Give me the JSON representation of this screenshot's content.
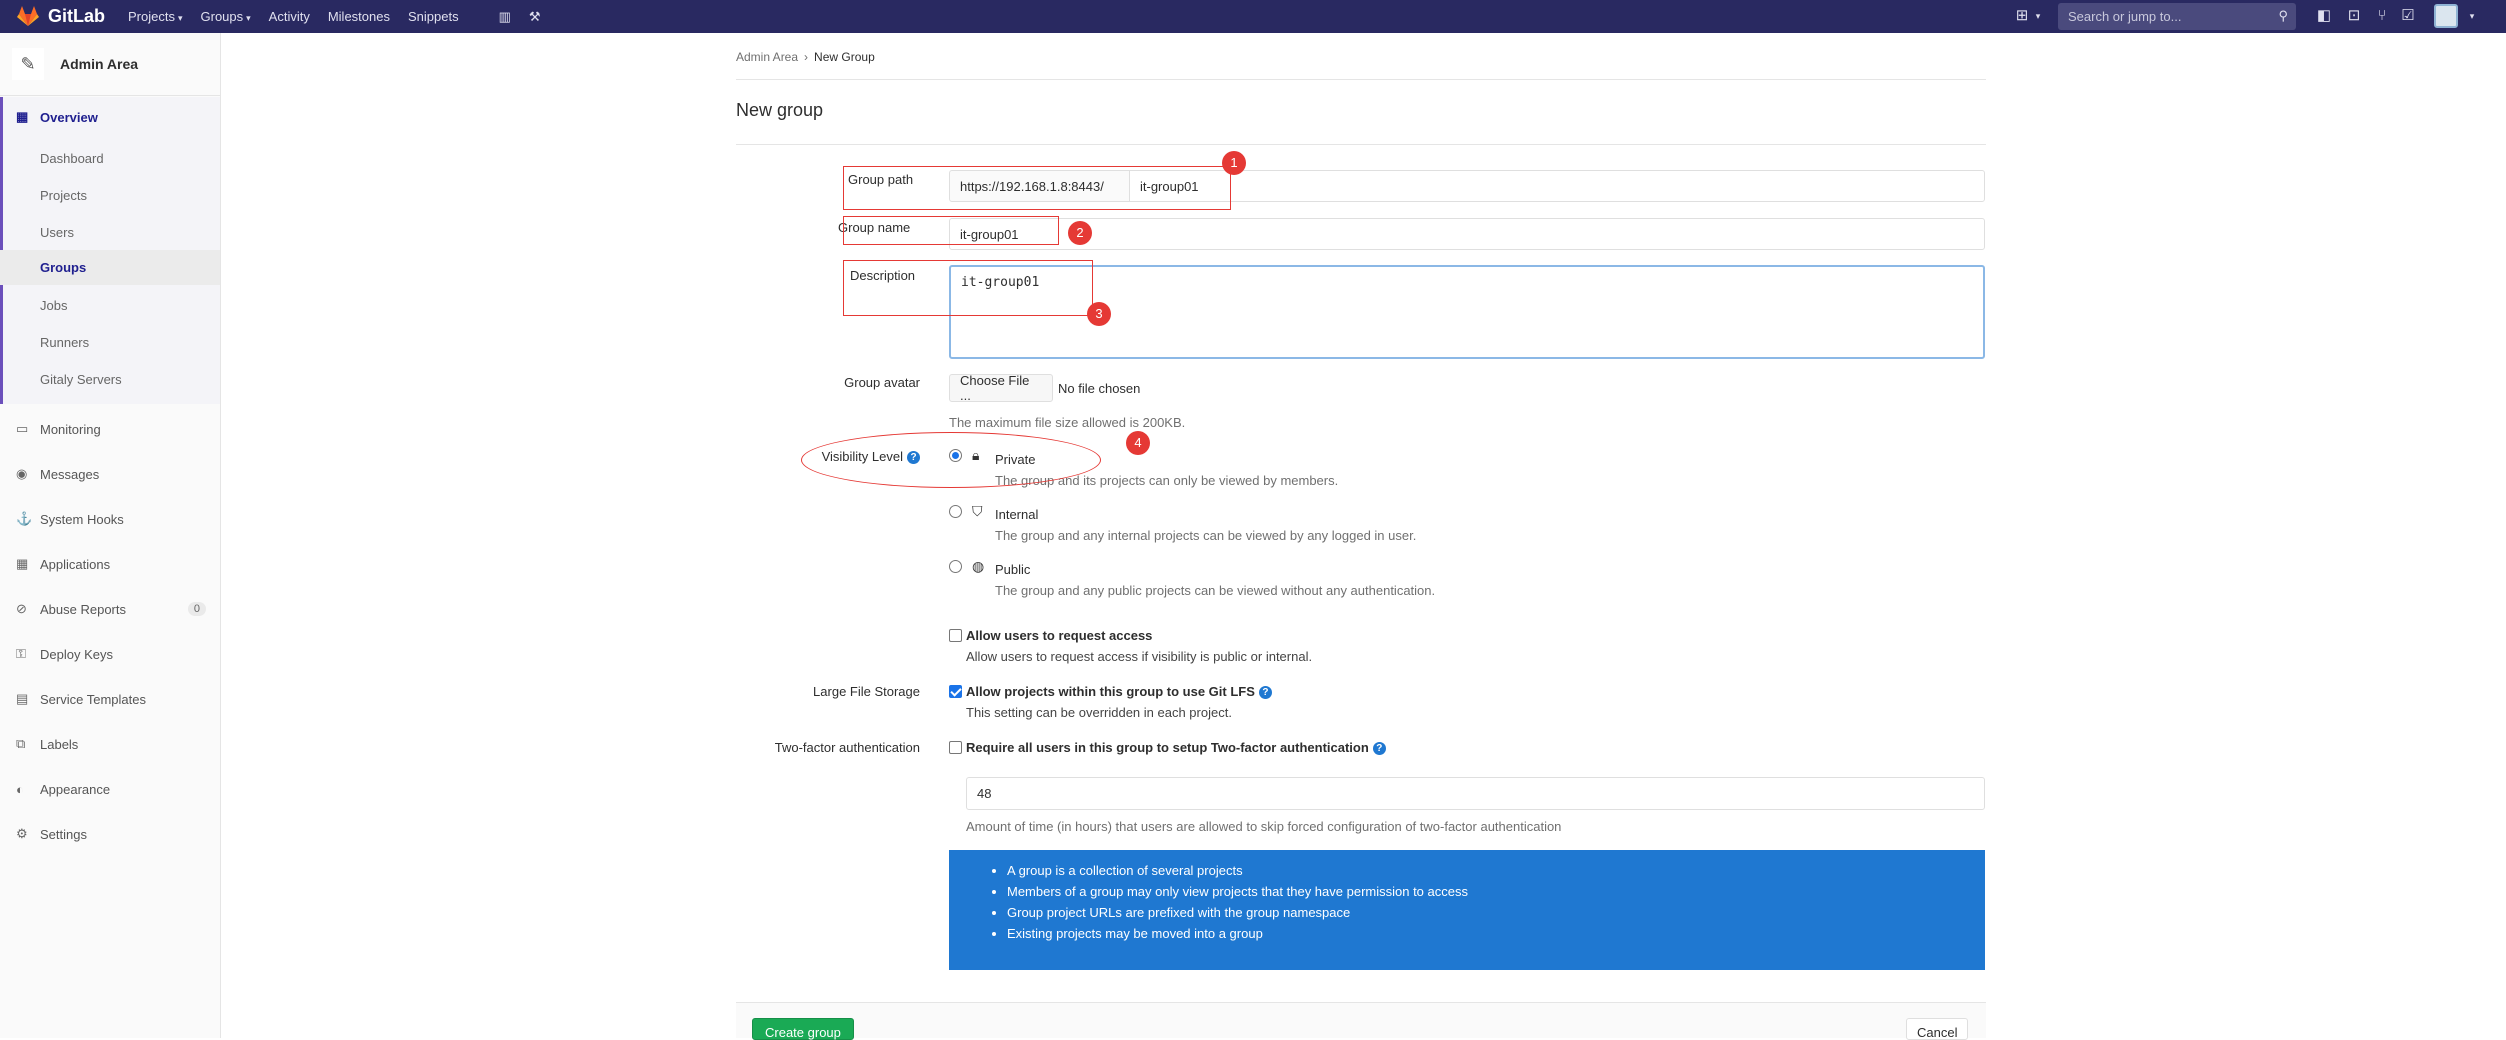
{
  "topbar": {
    "brand": "GitLab",
    "nav": [
      {
        "label": "Projects",
        "dropdown": true
      },
      {
        "label": "Groups",
        "dropdown": true
      },
      {
        "label": "Activity",
        "dropdown": false
      },
      {
        "label": "Milestones",
        "dropdown": false
      },
      {
        "label": "Snippets",
        "dropdown": false
      }
    ],
    "search_placeholder": "Search or jump to...",
    "brand_color": "#292961"
  },
  "sidebar": {
    "title": "Admin Area",
    "overview_label": "Overview",
    "sub_items": [
      "Dashboard",
      "Projects",
      "Users",
      "Groups",
      "Jobs",
      "Runners",
      "Gitaly Servers"
    ],
    "items": [
      {
        "label": "Monitoring",
        "icon": "monitor-icon"
      },
      {
        "label": "Messages",
        "icon": "broadcast-icon"
      },
      {
        "label": "System Hooks",
        "icon": "hook-icon"
      },
      {
        "label": "Applications",
        "icon": "apps-icon"
      },
      {
        "label": "Abuse Reports",
        "icon": "abuse-icon",
        "badge": "0"
      },
      {
        "label": "Deploy Keys",
        "icon": "key-icon"
      },
      {
        "label": "Service Templates",
        "icon": "template-icon"
      },
      {
        "label": "Labels",
        "icon": "label-icon"
      },
      {
        "label": "Appearance",
        "icon": "appearance-icon"
      },
      {
        "label": "Settings",
        "icon": "gear-icon"
      }
    ]
  },
  "breadcrumb": {
    "root": "Admin Area",
    "current": "New Group"
  },
  "page_title": "New group",
  "form": {
    "group_path_label": "Group path",
    "group_path_prefix": "https://192.168.1.8:8443/",
    "group_path_value": "it-group01",
    "group_name_label": "Group name",
    "group_name_value": "it-group01",
    "description_label": "Description",
    "description_value": "it-group01",
    "avatar_label": "Group avatar",
    "avatar_button": "Choose File ...",
    "avatar_status": "No file chosen",
    "avatar_help": "The maximum file size allowed is 200KB.",
    "visibility_label": "Visibility Level",
    "visibility_options": [
      {
        "label": "Private",
        "desc": "The group and its projects can only be viewed by members."
      },
      {
        "label": "Internal",
        "desc": "The group and any internal projects can be viewed by any logged in user."
      },
      {
        "label": "Public",
        "desc": "The group and any public projects can be viewed without any authentication."
      }
    ],
    "request_access_label": "Allow users to request access",
    "request_access_help": "Allow users to request access if visibility is public or internal.",
    "lfs_label": "Large File Storage",
    "lfs_check": "Allow projects within this group to use Git LFS",
    "lfs_help": "This setting can be overridden in each project.",
    "twofa_label": "Two-factor authentication",
    "twofa_check": "Require all users in this group to setup Two-factor authentication",
    "twofa_hours": "48",
    "twofa_help": "Amount of time (in hours) that users are allowed to skip forced configuration of two-factor authentication"
  },
  "info": [
    "A group is a collection of several projects",
    "Members of a group may only view projects that they have permission to access",
    "Group project URLs are prefixed with the group namespace",
    "Existing projects may be moved into a group"
  ],
  "buttons": {
    "create": "Create group",
    "cancel": "Cancel"
  },
  "annotations": [
    "1",
    "2",
    "3",
    "4"
  ]
}
